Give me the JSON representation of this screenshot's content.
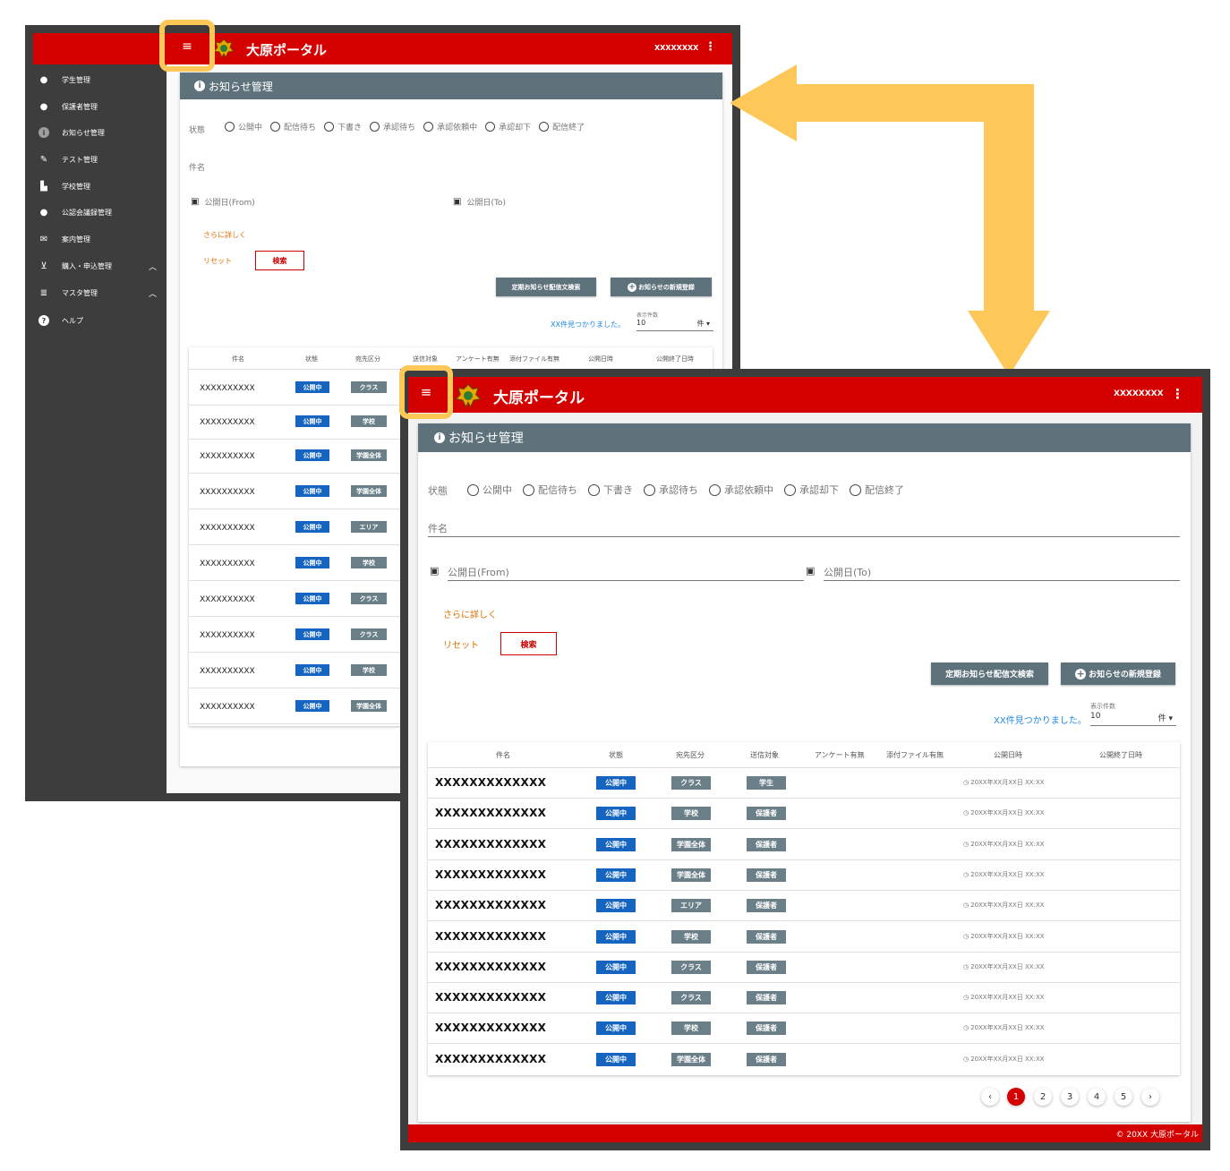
{
  "brand": "大原ポータル",
  "user": "XXXXXXXX",
  "colors": {
    "header": "#d40000",
    "panel": "#5e727b",
    "badge_blue": "#1565c0",
    "badge_gray": "#6b7f88",
    "highlight": "#fdc858",
    "arrow": "#fdc858"
  },
  "sidebar": {
    "items": [
      {
        "label": "学生管理",
        "icon": "person-icon"
      },
      {
        "label": "保護者管理",
        "icon": "person-icon"
      },
      {
        "label": "お知らせ管理",
        "icon": "info-icon"
      },
      {
        "label": "テスト管理",
        "icon": "pencil-icon"
      },
      {
        "label": "学校管理",
        "icon": "building-icon"
      },
      {
        "label": "公認会議録管理",
        "icon": "person-icon"
      },
      {
        "label": "案内管理",
        "icon": "mail-icon"
      },
      {
        "label": "購入・申込管理",
        "icon": "cart-icon"
      },
      {
        "label": "マスタ管理",
        "icon": "list-icon"
      },
      {
        "label": "ヘルプ",
        "icon": "help-icon"
      }
    ]
  },
  "panel_title": "お知らせ管理",
  "filters": {
    "status_label": "状態",
    "status_options": [
      "公開中",
      "配信待ち",
      "下書き",
      "承認待ち",
      "承認依頼中",
      "承認却下",
      "配信終了"
    ],
    "subject_label": "件名",
    "date_from_label": "公開日(From)",
    "date_to_label": "公開日(To)",
    "more_link": "さらに詳しく",
    "reset": "リセット",
    "search": "検索"
  },
  "actions": {
    "scheduled_search": "定期お知らせ配信文検索",
    "new": "お知らせの新規登録"
  },
  "results": {
    "found_text": "XX件見つかりました。",
    "per_page_label": "表示件数",
    "per_page_value": "10",
    "per_page_unit": "件"
  },
  "table": {
    "headers": [
      "件名",
      "状態",
      "宛先区分",
      "送信対象",
      "アンケート有無",
      "添付ファイル有無",
      "公開日時",
      "公開終了日時"
    ],
    "rows": [
      {
        "subject": "XXXXXXXXXXXXX",
        "status": "公開中",
        "dest": "クラス",
        "target": "学生",
        "date": "20XX年XX月XX日 XX:XX"
      },
      {
        "subject": "XXXXXXXXXXXXX",
        "status": "公開中",
        "dest": "学校",
        "target": "保護者",
        "date": "20XX年XX月XX日 XX:XX"
      },
      {
        "subject": "XXXXXXXXXXXXX",
        "status": "公開中",
        "dest": "学園全体",
        "target": "保護者",
        "date": "20XX年XX月XX日 XX:XX"
      },
      {
        "subject": "XXXXXXXXXXXXX",
        "status": "公開中",
        "dest": "学園全体",
        "target": "保護者",
        "date": "20XX年XX月XX日 XX:XX"
      },
      {
        "subject": "XXXXXXXXXXXXX",
        "status": "公開中",
        "dest": "エリア",
        "target": "保護者",
        "date": "20XX年XX月XX日 XX:XX"
      },
      {
        "subject": "XXXXXXXXXXXXX",
        "status": "公開中",
        "dest": "学校",
        "target": "保護者",
        "date": "20XX年XX月XX日 XX:XX"
      },
      {
        "subject": "XXXXXXXXXXXXX",
        "status": "公開中",
        "dest": "クラス",
        "target": "保護者",
        "date": "20XX年XX月XX日 XX:XX"
      },
      {
        "subject": "XXXXXXXXXXXXX",
        "status": "公開中",
        "dest": "クラス",
        "target": "保護者",
        "date": "20XX年XX月XX日 XX:XX"
      },
      {
        "subject": "XXXXXXXXXXXXX",
        "status": "公開中",
        "dest": "学校",
        "target": "保護者",
        "date": "20XX年XX月XX日 XX:XX"
      },
      {
        "subject": "XXXXXXXXXXXXX",
        "status": "公開中",
        "dest": "学園全体",
        "target": "保護者",
        "date": "20XX年XX月XX日 XX:XX"
      }
    ]
  },
  "win1_rows": [
    {
      "subject": "XXXXXXXXXX",
      "status": "公開中",
      "dest": "クラス"
    },
    {
      "subject": "XXXXXXXXXX",
      "status": "公開中",
      "dest": "学校"
    },
    {
      "subject": "XXXXXXXXXX",
      "status": "公開中",
      "dest": "学園全体"
    },
    {
      "subject": "XXXXXXXXXX",
      "status": "公開中",
      "dest": "学園全体"
    },
    {
      "subject": "XXXXXXXXXX",
      "status": "公開中",
      "dest": "エリア"
    },
    {
      "subject": "XXXXXXXXXX",
      "status": "公開中",
      "dest": "学校"
    },
    {
      "subject": "XXXXXXXXXX",
      "status": "公開中",
      "dest": "クラス"
    },
    {
      "subject": "XXXXXXXXXX",
      "status": "公開中",
      "dest": "クラス"
    },
    {
      "subject": "XXXXXXXXXX",
      "status": "公開中",
      "dest": "学校"
    },
    {
      "subject": "XXXXXXXXXX",
      "status": "公開中",
      "dest": "学園全体"
    }
  ],
  "pagination": {
    "pages": [
      "1",
      "2",
      "3",
      "4",
      "5"
    ],
    "current": "1",
    "prev": "‹",
    "next": "›"
  },
  "footer": "© 20XX 大原ポータル"
}
